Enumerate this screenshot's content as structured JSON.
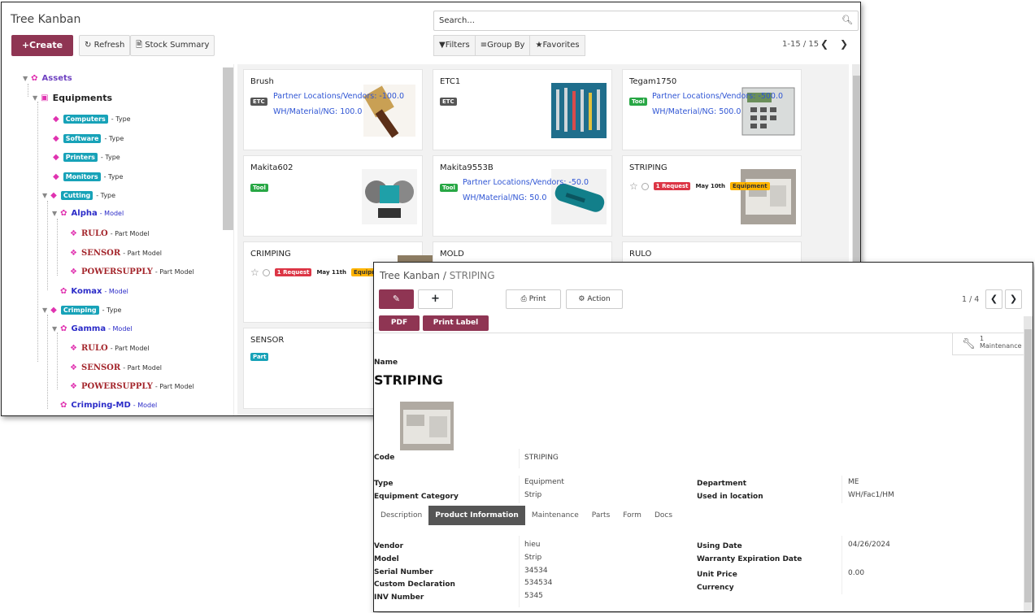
{
  "kanban_window": {
    "title": "Tree Kanban",
    "search_placeholder": "Search...",
    "create_label": "Create",
    "refresh_label": "Refresh",
    "stock_summary_label": "Stock Summary",
    "filters_label": "Filters",
    "group_by_label": "Group By",
    "favorites_label": "Favorites",
    "pager": "1-15 / 15",
    "tree": {
      "assets": "Assets",
      "equipments": "Equipments",
      "type_label": "- Type",
      "model_label": "- Model",
      "part_model_label": "- Part Model",
      "computers": "Computers",
      "software": "Software",
      "printers": "Printers",
      "monitors": "Monitors",
      "cutting": "Cutting",
      "alpha": "Alpha",
      "rulo": "RULO",
      "sensor": "SENSOR",
      "powersupply": "POWERSUPPLY",
      "komax": "Komax",
      "crimping": "Crimping",
      "gamma": "Gamma",
      "crimping_md": "Crimping-MD"
    },
    "cards": {
      "brush": {
        "title": "Brush",
        "tag": "ETC",
        "loc": "Partner Locations/Vendors: -100.0",
        "wh": "WH/Material/NG: 100.0"
      },
      "etc1": {
        "title": "ETC1",
        "tag": "ETC"
      },
      "tegam": {
        "title": "Tegam1750",
        "tag": "Tool",
        "loc": "Partner Locations/Vendors: -500.0",
        "wh": "WH/Material/NG: 500.0"
      },
      "makita602": {
        "title": "Makita602",
        "tag": "Tool"
      },
      "makita9553": {
        "title": "Makita9553B",
        "tag": "Tool",
        "loc": "Partner Locations/Vendors: -50.0",
        "wh": "WH/Material/NG: 50.0"
      },
      "striping": {
        "title": "STRIPING",
        "request": "1 Request",
        "date": "May 10th",
        "tag": "Equipment"
      },
      "crimping": {
        "title": "CRIMPING",
        "request": "1 Request",
        "date": "May 11th",
        "tag": "Equipment"
      },
      "mold": {
        "title": "MOLD"
      },
      "rulo": {
        "title": "RULO"
      },
      "sensor": {
        "title": "SENSOR",
        "tag": "Part"
      }
    }
  },
  "form_window": {
    "breadcrumb_root": "Tree Kanban",
    "breadcrumb_sep": " / ",
    "breadcrumb_current": "STRIPING",
    "print_label": "Print",
    "action_label": "Action",
    "pager": "1 / 4",
    "pdf_label": "PDF",
    "print_label_btn": "Print Label",
    "maintenance_count": "1",
    "maintenance_label": "Maintenance",
    "name_label": "Name",
    "record_title": "STRIPING",
    "code_label": "Code",
    "code_value": "STRIPING",
    "type_label": "Type",
    "type_value": "Equipment",
    "equipment_category_label": "Equipment Category",
    "equipment_category_value": "Strip",
    "department_label": "Department",
    "department_value": "ME",
    "used_in_location_label": "Used in location",
    "used_in_location_value": "WH/Fac1/HM",
    "tabs": [
      "Description",
      "Product Information",
      "Maintenance",
      "Parts",
      "Form",
      "Docs"
    ],
    "active_tab": "Product Information",
    "vendor_label": "Vendor",
    "vendor_value": "hieu",
    "model_label": "Model",
    "model_value": "Strip",
    "serial_number_label": "Serial Number",
    "serial_number_value": "34534",
    "custom_declaration_label": "Custom Declaration",
    "custom_declaration_value": "534534",
    "inv_number_label": "INV Number",
    "inv_number_value": "5345",
    "using_date_label": "Using Date",
    "using_date_value": "04/26/2024",
    "warranty_label": "Warranty Expiration Date",
    "unit_price_label": "Unit Price",
    "unit_price_value": "0.00",
    "currency_label": "Currency"
  },
  "colors": {
    "brand": "#8f3553",
    "pill_type": "#17a2b8",
    "request": "#dc3545",
    "equipment_tag": "#ffb400",
    "tool_tag": "#28a745",
    "etc_tag": "#555555"
  },
  "icons": [
    "plus-icon",
    "refresh-icon",
    "document-icon",
    "search-icon",
    "filter-icon",
    "list-icon",
    "star-icon",
    "chevron-left-icon",
    "chevron-right-icon",
    "pencil-icon",
    "print-icon",
    "gear-icon",
    "wrench-icon",
    "flower-icon",
    "tag-icon",
    "clock-icon"
  ]
}
